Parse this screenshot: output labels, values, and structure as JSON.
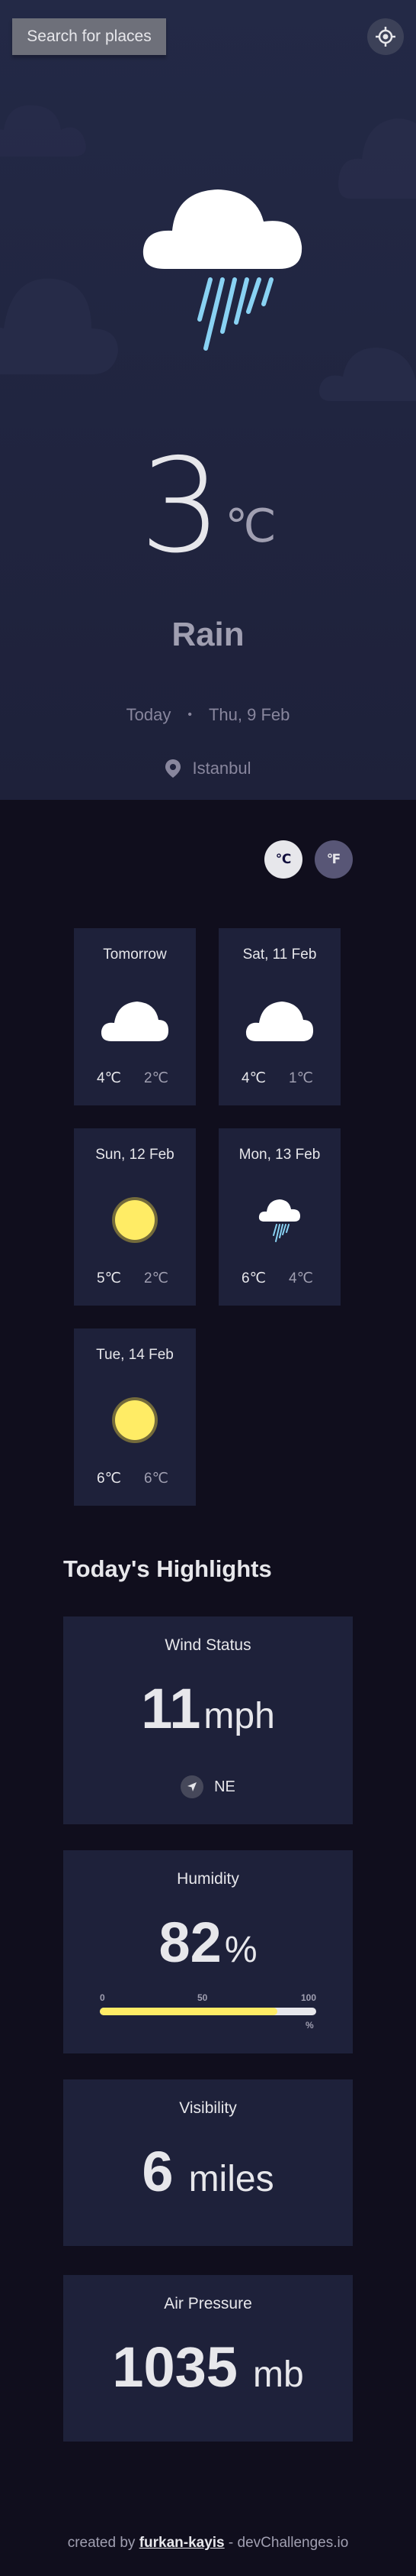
{
  "search": {
    "label": "Search for places"
  },
  "icons": {
    "location_button": "gps-crosshair-icon",
    "place": "map-pin-icon",
    "wind_direction": "navigation-arrow-icon"
  },
  "current": {
    "temperature": "3",
    "unit": "℃",
    "condition": "Rain",
    "icon": "cloud-rain-icon",
    "day": "Today",
    "separator": "•",
    "date": "Thu, 9 Feb",
    "location": "Istanbul"
  },
  "units": {
    "celsius": "℃",
    "fahrenheit": "℉",
    "selected": "celsius"
  },
  "forecast": [
    {
      "day": "Tomorrow",
      "icon": "cloud-icon",
      "max": "4℃",
      "min": "2℃"
    },
    {
      "day": "Sat, 11 Feb",
      "icon": "cloud-icon",
      "max": "4℃",
      "min": "1℃"
    },
    {
      "day": "Sun, 12 Feb",
      "icon": "sun-icon",
      "max": "5℃",
      "min": "2℃"
    },
    {
      "day": "Mon, 13 Feb",
      "icon": "cloud-rain-icon",
      "max": "6℃",
      "min": "4℃"
    },
    {
      "day": "Tue, 14 Feb",
      "icon": "sun-icon",
      "max": "6℃",
      "min": "6℃"
    }
  ],
  "highlights": {
    "title": "Today's Highlights",
    "wind": {
      "label": "Wind Status",
      "value": "11",
      "unit": "mph",
      "direction": "NE"
    },
    "humidity": {
      "label": "Humidity",
      "value": "82",
      "unit": "%",
      "fraction": 0.82,
      "scale_min": "0",
      "scale_mid": "50",
      "scale_max": "100",
      "scale_unit": "%"
    },
    "visibility": {
      "label": "Visibility",
      "value": "6",
      "unit": "miles"
    },
    "pressure": {
      "label": "Air Pressure",
      "value": "1035",
      "unit": "mb"
    }
  },
  "footer": {
    "prefix": "created by ",
    "author": "furkan-kayis",
    "suffix": " - devChallenges.io"
  },
  "colors": {
    "panel": "#1E213A",
    "background": "#100E1D",
    "accent_yellow": "#FFEC65",
    "rain": "#89D2F3",
    "text": "#E7E7EB",
    "muted": "#A09FB1"
  }
}
